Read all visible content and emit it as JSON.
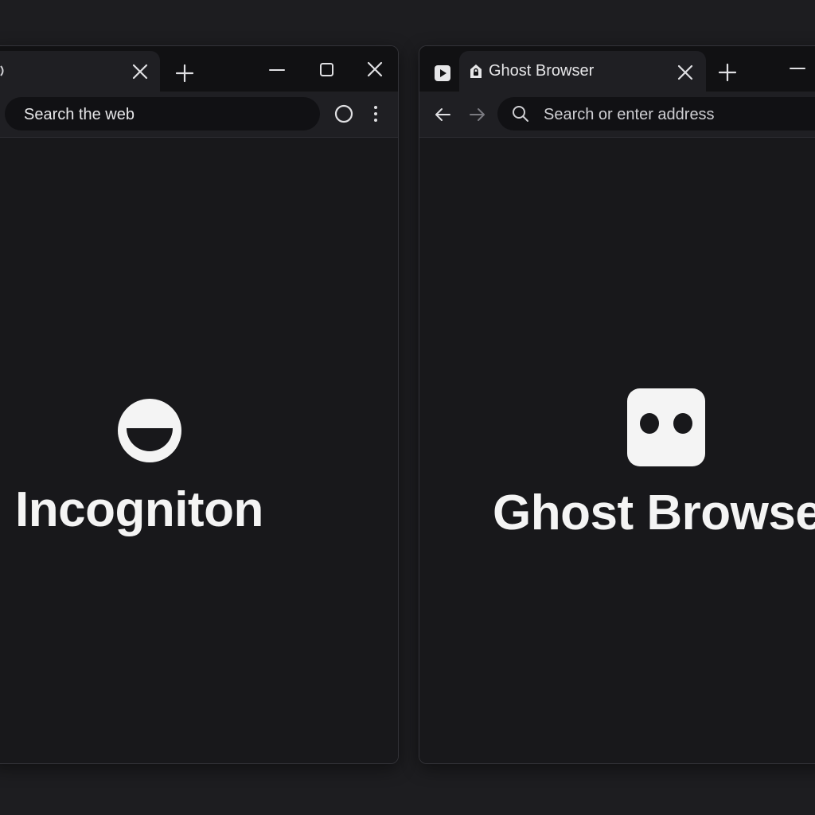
{
  "theme": {
    "desktop_bg": "#1d1d20",
    "window_bg": "#18181b",
    "titlebar_bg": "#111113",
    "toolbar_bg": "#1f1f23",
    "text": "#e8e8ea",
    "logo_fill": "#f4f4f4"
  },
  "window_a": {
    "tab": {
      "favicon": "partial-icon",
      "close_icon": "close-icon"
    },
    "new_tab_icon": "plus-icon",
    "window_controls": [
      "minimize-icon",
      "maximize-icon",
      "close-icon"
    ],
    "search": {
      "placeholder": "Search the web",
      "value": ""
    },
    "toolbar_icons": [
      "circle-icon",
      "kebab-menu-icon"
    ],
    "brand": {
      "logo": "smiling-face-logo",
      "name": "Incogniton"
    }
  },
  "window_b": {
    "pinned_tab_icon": "play-icon",
    "tab": {
      "favicon": "lock-icon",
      "title": "Ghost Browser",
      "close_icon": "close-icon"
    },
    "new_tab_icon": "plus-icon",
    "window_controls": [
      "minimize-icon"
    ],
    "nav_icons": [
      "back-arrow-icon",
      "forward-arrow-icon"
    ],
    "address": {
      "placeholder": "Search or enter address",
      "value": "",
      "icon": "search-icon"
    },
    "brand": {
      "logo": "ghost-eyes-logo",
      "name": "Ghost Browser"
    }
  }
}
